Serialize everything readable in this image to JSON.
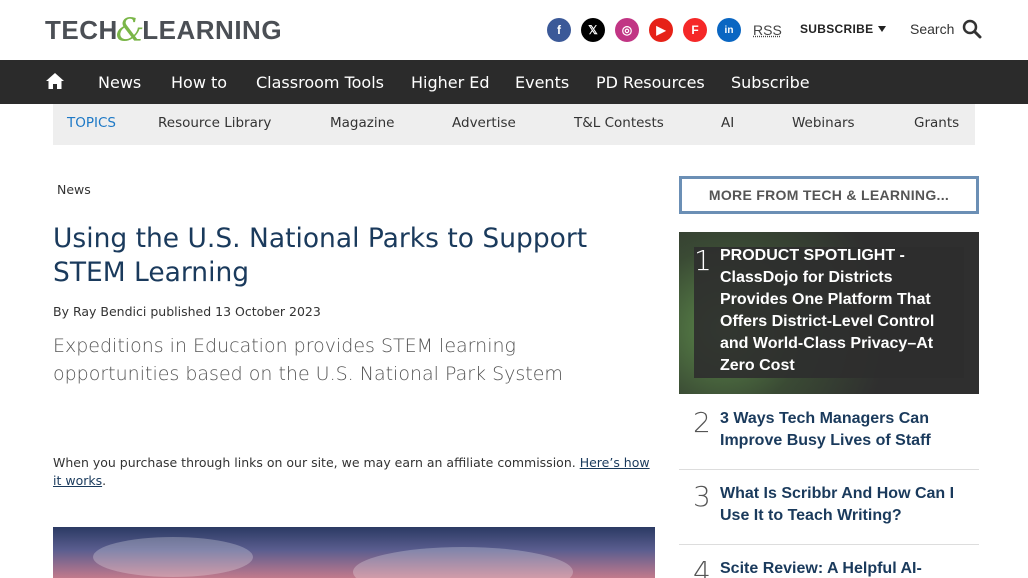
{
  "header": {
    "logo_part1": "TECH",
    "logo_amp": "&",
    "logo_part2": "LEARNING",
    "rss": "RSS",
    "subscribe": "SUBSCRIBE",
    "search": "Search",
    "socials": [
      {
        "name": "facebook-icon",
        "glyph": "f"
      },
      {
        "name": "x-icon",
        "glyph": "𝕏"
      },
      {
        "name": "instagram-icon",
        "glyph": "◎"
      },
      {
        "name": "youtube-icon",
        "glyph": "▶"
      },
      {
        "name": "flipboard-icon",
        "glyph": "F"
      },
      {
        "name": "linkedin-icon",
        "glyph": "in"
      }
    ]
  },
  "nav": {
    "items": [
      "News",
      "How to",
      "Classroom Tools",
      "Higher Ed",
      "Events",
      "PD Resources",
      "Subscribe"
    ]
  },
  "topics": {
    "label": "TOPICS",
    "items": [
      "Resource Library",
      "Magazine",
      "Advertise",
      "T&L Contests",
      "AI",
      "Webinars",
      "Grants"
    ]
  },
  "article": {
    "breadcrumb": "News",
    "headline": "Using the U.S. National Parks to Support STEM Learning",
    "by": "By",
    "author": "Ray Bendici",
    "published": "published",
    "date": "13 October 2023",
    "standfirst": "Expeditions in Education provides STEM learning opportunities based on the U.S. National Park System",
    "affiliate_text": "When you purchase through links on our site, we may earn an affiliate commission.",
    "affiliate_link": "Here’s how it works",
    "affiliate_end": "."
  },
  "sidebar": {
    "heading": "MORE FROM TECH & LEARNING...",
    "featured": {
      "num": "1",
      "title": "PRODUCT SPOTLIGHT - ClassDojo for Districts Provides One Platform That Offers District-Level Control and World-Class Privacy–At Zero Cost"
    },
    "items": [
      {
        "num": "2",
        "title": "3 Ways Tech Managers Can Improve Busy Lives of Staff"
      },
      {
        "num": "3",
        "title": "What Is Scribbr And How Can I Use It to Teach Writing?"
      },
      {
        "num": "4",
        "title": "Scite Review: A Helpful AI-"
      }
    ]
  }
}
